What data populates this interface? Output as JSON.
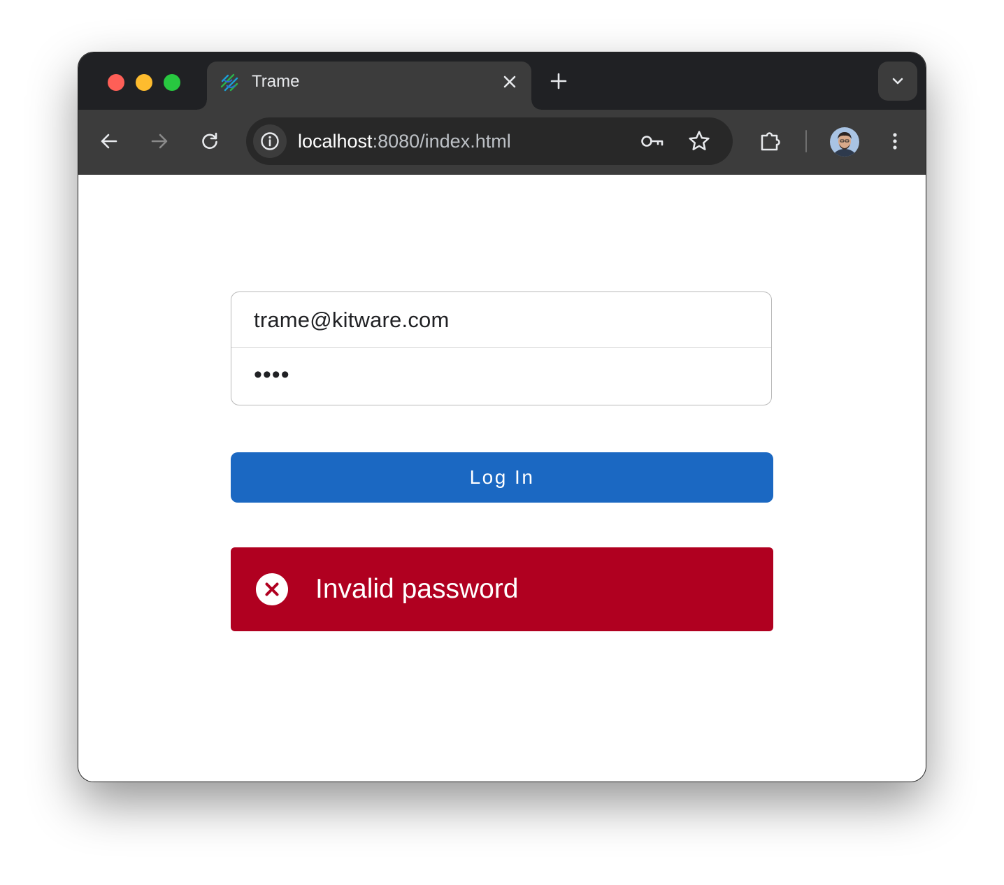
{
  "browser": {
    "tab": {
      "title": "Trame",
      "favicon": "trame-logo-icon"
    },
    "address_bar": {
      "host": "localhost",
      "path": ":8080/index.html"
    },
    "profile": "avatar"
  },
  "login_form": {
    "email_value": "trame@kitware.com",
    "password_masked": "••••",
    "login_button_label": "Log In"
  },
  "alert": {
    "icon": "error-circle-icon",
    "message": "Invalid password"
  },
  "colors": {
    "button_primary": "#1b68c2",
    "alert_error": "#b00020",
    "tab_strip": "#202124",
    "toolbar": "#3c3c3c"
  }
}
